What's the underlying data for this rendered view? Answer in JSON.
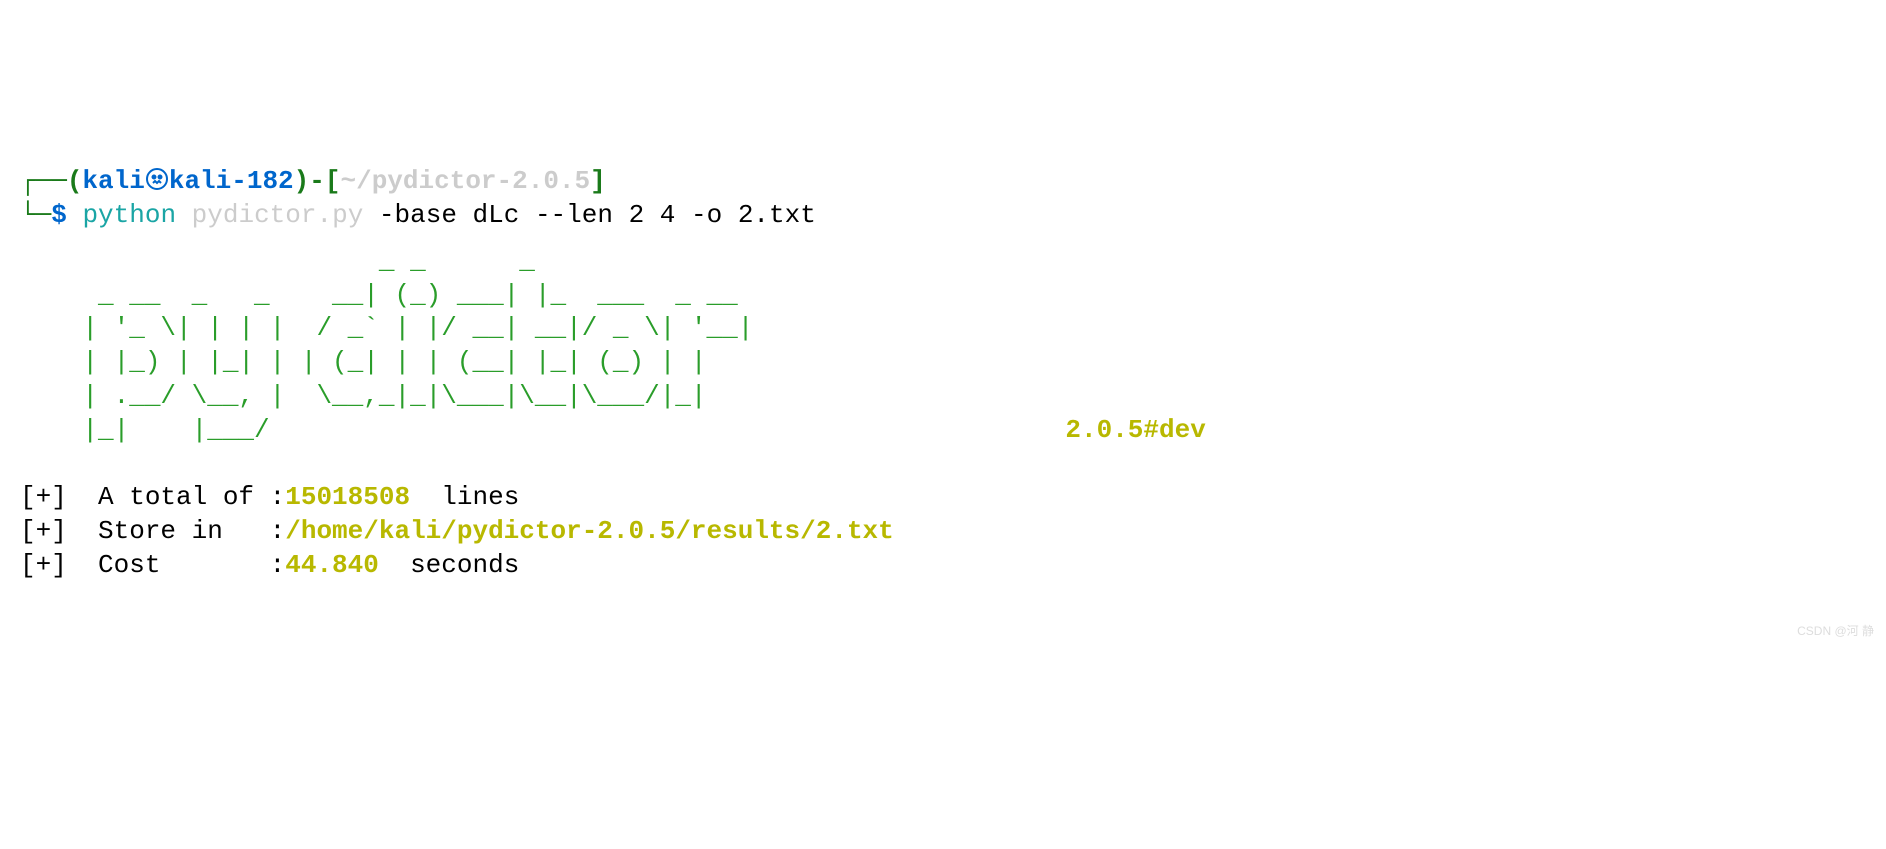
{
  "prompt": {
    "box_tl": "┌──",
    "box_bl": "└─",
    "paren_open": "(",
    "user": "kali",
    "host": "kali-182",
    "paren_close": ")",
    "dash_bracket": "-[",
    "cwd": "~/pydictor-2.0.5",
    "bracket_close": "]",
    "dollar": "$ "
  },
  "command": {
    "interpreter": "python",
    "script": " pydictor.py ",
    "arg1_flag": "-base ",
    "arg1_val": "dLc ",
    "arg2_flag": "--len ",
    "arg2_val": "2 4 ",
    "arg3_flag": "-o ",
    "arg3_val": "2.txt"
  },
  "ascii": {
    "banner": "                       _ _      _                \n     _ __  _   _    __| (_) ___| |_  ___  _ __   \n    | '_ \\| | | |  / _` | |/ __| __|/ _ \\| '__|  \n    | |_) | |_| | | (_| | | (__| |_| (_) | |     \n    | .__/ \\__, |  \\__,_|_|\\___|\\__|\\___/|_|     ",
    "lastline": "    |_|    |___/                                 ",
    "version": "2.0.5#dev"
  },
  "output": {
    "line1_prefix": "[+]  A total of :",
    "line1_value": "15018508",
    "line1_suffix": "  lines",
    "line2_prefix": "[+]  Store in   :",
    "line2_value": "/home/kali/pydictor-2.0.5/results/2.txt",
    "line3_prefix": "[+]  Cost       :",
    "line3_value": "44.840",
    "line3_suffix": "  seconds"
  },
  "watermark": "CSDN @河 静"
}
